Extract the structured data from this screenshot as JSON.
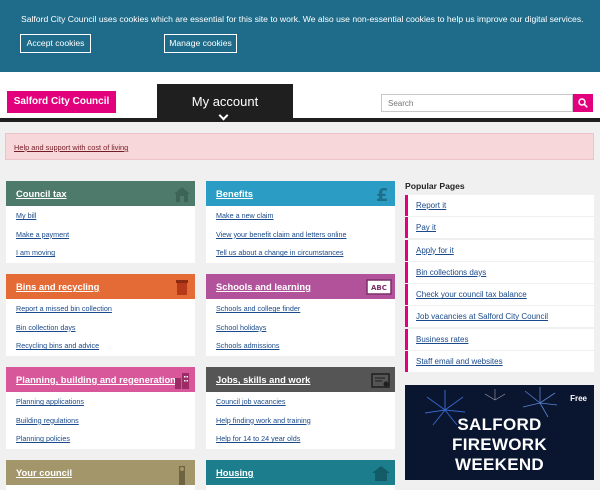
{
  "cookie": {
    "text": "Salford City Council uses cookies which are essential for this site to work. We also use non-essential cookies to help us improve our digital services.",
    "accept_label": "Accept cookies",
    "manage_label": "Manage cookies"
  },
  "header": {
    "logo": "Salford City Council",
    "my_account": "My account",
    "search_placeholder": "Search"
  },
  "alert": {
    "link": "Help and support with cost of living"
  },
  "cards": [
    {
      "title": "Council tax",
      "color": "#4d7a6b",
      "icon": "house-icon",
      "links": [
        "My bill",
        "Make a payment",
        "I am moving"
      ]
    },
    {
      "title": "Benefits",
      "color": "#2b9dc4",
      "icon": "pound-icon",
      "links": [
        "Make a new claim",
        "View your benefit claim and letters online",
        "Tell us about a change in circumstances"
      ]
    },
    {
      "title": "Bins and recycling",
      "color": "#e56b36",
      "icon": "bin-icon",
      "links": [
        "Report a missed bin collection",
        "Bin collection days",
        "Recycling bins and advice"
      ]
    },
    {
      "title": "Schools and learning",
      "color": "#b1529a",
      "icon": "blackboard-icon",
      "links": [
        "Schools and college finder",
        "School holidays",
        "Schools admissions"
      ]
    },
    {
      "title": "Planning, building and regeneration",
      "color": "#d8569a",
      "icon": "buildings-icon",
      "links": [
        "Planning applications",
        "Building regulations",
        "Planning policies"
      ]
    },
    {
      "title": "Jobs, skills and work",
      "color": "#555555",
      "icon": "certificate-icon",
      "links": [
        "Council job vacancies",
        "Help finding work and training",
        "Help for 14 to 24 year olds"
      ]
    },
    {
      "title": "Your council",
      "color": "#a3966a",
      "icon": "tower-icon",
      "links": []
    },
    {
      "title": "Housing",
      "color": "#1c7e8c",
      "icon": "house-icon",
      "links": []
    }
  ],
  "popular": {
    "title": "Popular Pages",
    "items": [
      "Report it",
      "Pay it",
      "Apply for it",
      "Bin collections days",
      "Check your council tax balance",
      "Job vacancies at Salford City Council",
      "Business rates",
      "Staff email and websites"
    ]
  },
  "ad": {
    "free": "Free",
    "line1": "SALFORD",
    "line2": "FIREWORK",
    "line3": "WEEKEND"
  },
  "colors": {
    "brand": "#e3007d",
    "cookie_bg": "#1f6c8a",
    "header_dark": "#1f1f1f"
  }
}
